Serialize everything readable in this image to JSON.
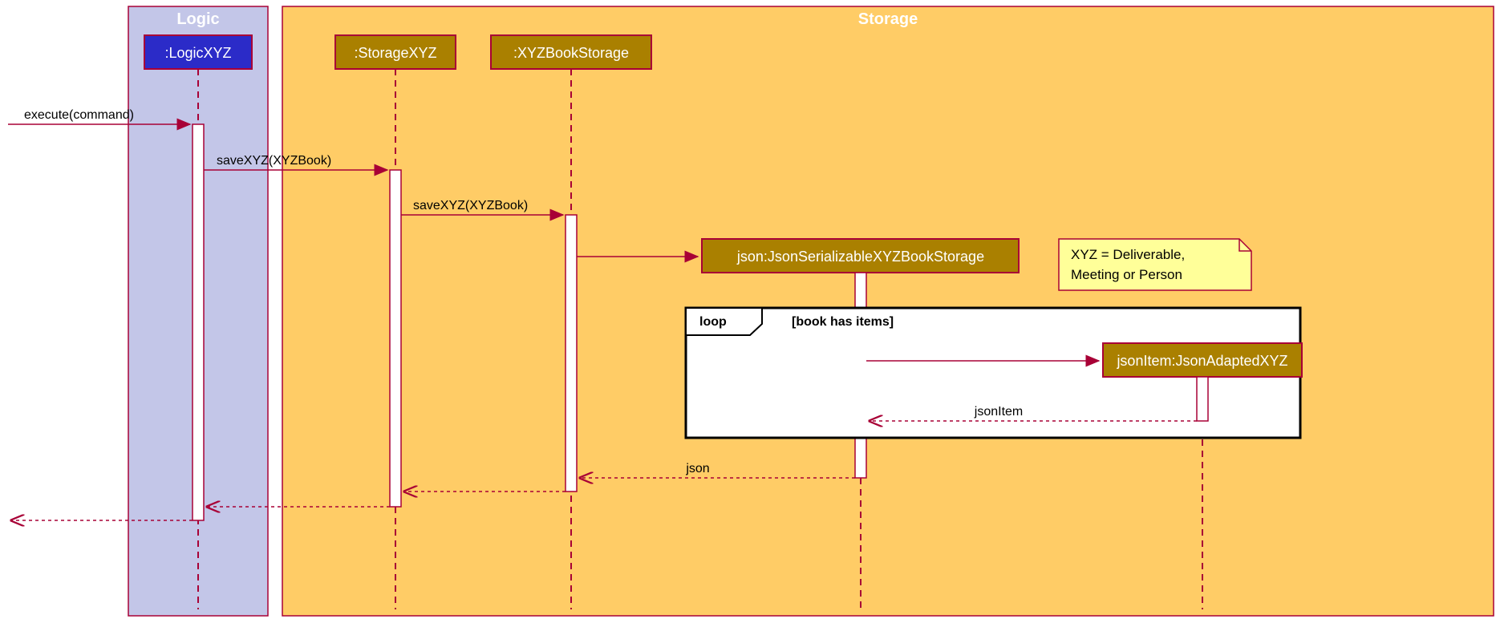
{
  "frames": {
    "logic": "Logic",
    "storage": "Storage"
  },
  "participants": {
    "logicXYZ": ":LogicXYZ",
    "storageXYZ": ":StorageXYZ",
    "xyzBookStorage": ":XYZBookStorage",
    "jsonSerializable": "json:JsonSerializableXYZBookStorage",
    "jsonAdapted": "jsonItem:JsonAdaptedXYZ"
  },
  "messages": {
    "execute": "execute(command)",
    "saveXYZ1": "saveXYZ(XYZBook)",
    "saveXYZ2": "saveXYZ(XYZBook)",
    "json": "json",
    "jsonItem": "jsonItem"
  },
  "loop": {
    "label": "loop",
    "guard": "[book has items]"
  },
  "note": {
    "line1": "XYZ = Deliverable,",
    "line2": "Meeting or Person"
  }
}
